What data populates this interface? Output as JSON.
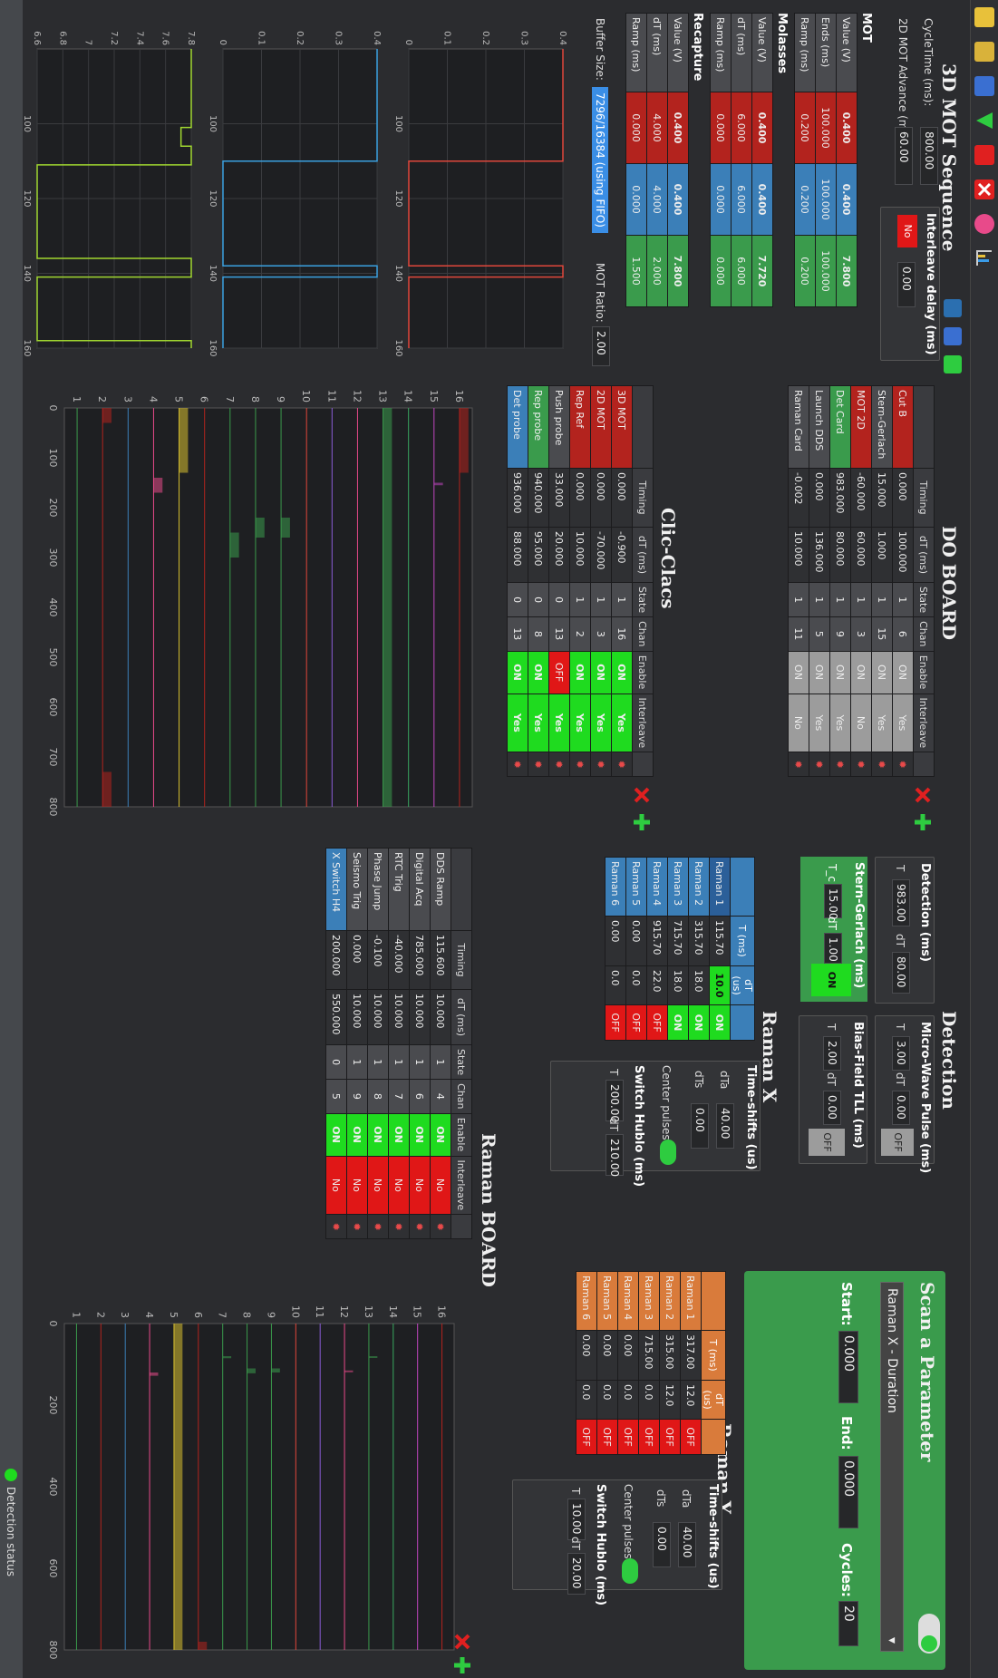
{
  "app": {
    "title": "3D MOT Sequence"
  },
  "sequence": {
    "cycle_label": "CycleTime (ms):",
    "cycle_value": "800.00",
    "advance_label": "2D MOT Advance (m",
    "advance_value": "60.00",
    "interleave_label": "Interleave delay (ms)",
    "interleave_toggle": "No",
    "interleave_value": "0.00",
    "buffer_label": "Buffer Size:",
    "buffer_value": "7296/16384 (using FIFO)",
    "mot_ratio_label": "MOT Ratio:",
    "mot_ratio_value": "2.00",
    "groups": [
      {
        "name": "MOT",
        "rows": [
          {
            "label": "Value (V)",
            "cells": [
              "0.400",
              "0.400",
              "7.800"
            ]
          },
          {
            "label": "Ends (ms)",
            "cells": [
              "100.000",
              "100.000",
              "100.000"
            ]
          },
          {
            "label": "Ramp (ms)",
            "cells": [
              "0.200",
              "0.200",
              "0.200"
            ]
          }
        ]
      },
      {
        "name": "Molasses",
        "rows": [
          {
            "label": "Value (V)",
            "cells": [
              "0.400",
              "0.400",
              "7.720"
            ]
          },
          {
            "label": "dT (ms)",
            "cells": [
              "6.000",
              "6.000",
              "6.000"
            ]
          },
          {
            "label": "Ramp (ms)",
            "cells": [
              "0.000",
              "0.000",
              "0.000"
            ]
          }
        ]
      },
      {
        "name": "Recapture",
        "rows": [
          {
            "label": "Value (V)",
            "cells": [
              "0.400",
              "0.400",
              "7.800"
            ]
          },
          {
            "label": "dT (ms)",
            "cells": [
              "4.000",
              "4.000",
              "2.000"
            ]
          },
          {
            "label": "Ramp (ms)",
            "cells": [
              "0.000",
              "0.000",
              "1.500"
            ]
          }
        ]
      }
    ]
  },
  "do_board": {
    "title": "DO BOARD",
    "headers": [
      "",
      "Timing",
      "dT (ms)",
      "State",
      "Chan",
      "Enable",
      "Interleave",
      ""
    ],
    "rows": [
      {
        "name": "Cut B",
        "t": "0.000",
        "dt": "100.000",
        "state": "1",
        "chan": "6",
        "enable": "ON",
        "inter": "Yes"
      },
      {
        "name": "Stern-Gerlach",
        "t": "15.000",
        "dt": "1.000",
        "state": "1",
        "chan": "15",
        "enable": "ON",
        "inter": "Yes"
      },
      {
        "name": "MOT 2D",
        "t": "-60.000",
        "dt": "60.000",
        "state": "1",
        "chan": "3",
        "enable": "ON",
        "inter": "No"
      },
      {
        "name": "Det Card",
        "t": "983.000",
        "dt": "80.000",
        "state": "1",
        "chan": "9",
        "enable": "ON",
        "inter": "Yes"
      },
      {
        "name": "Launch DDS",
        "t": "0.000",
        "dt": "136.000",
        "state": "1",
        "chan": "5",
        "enable": "ON",
        "inter": "Yes"
      },
      {
        "name": "Raman Card",
        "t": "-0.002",
        "dt": "10.000",
        "state": "1",
        "chan": "11",
        "enable": "ON",
        "inter": "No"
      }
    ]
  },
  "clic_clacs": {
    "title": "Clic-Clacs",
    "headers": [
      "",
      "Timing",
      "dT (ms)",
      "State",
      "Chan",
      "Enable",
      "Interleave",
      ""
    ],
    "rows": [
      {
        "name": "3D MOT",
        "t": "0.000",
        "dt": "-0.900",
        "state": "1",
        "chan": "16",
        "enable": "ON",
        "inter": "Yes"
      },
      {
        "name": "2D MOT",
        "t": "0.000",
        "dt": "-70.000",
        "state": "1",
        "chan": "3",
        "enable": "ON",
        "inter": "Yes"
      },
      {
        "name": "Rep Ref",
        "t": "0.000",
        "dt": "10.000",
        "state": "1",
        "chan": "2",
        "enable": "ON",
        "inter": "Yes"
      },
      {
        "name": "Push probe",
        "t": "33.000",
        "dt": "20.000",
        "state": "0",
        "chan": "13",
        "enable": "OFF",
        "inter": "Yes"
      },
      {
        "name": "Rep probe",
        "t": "940.000",
        "dt": "95.000",
        "state": "0",
        "chan": "8",
        "enable": "ON",
        "inter": "Yes"
      },
      {
        "name": "Det probe",
        "t": "936.000",
        "dt": "88.000",
        "state": "0",
        "chan": "13",
        "enable": "ON",
        "inter": "Yes"
      }
    ]
  },
  "detection": {
    "title": "Detection",
    "det_label": "Detection (ms)",
    "det_t": "983.00",
    "det_dt": "80.00",
    "mw_label": "Micro-Wave Pulse (ms)",
    "mw_t": "3.00",
    "mw_dt": "0.00",
    "mw_state": "OFF",
    "sg_label": "Stern-Gerlach (ms)",
    "sg_t": "15.00",
    "sg_dt": "1.00",
    "sg_state": "ON",
    "bias_label": "Bias-Field TLL (ms)",
    "bias_t": "2.00",
    "bias_dt": "0.00",
    "bias_state": "OFF",
    "t_lbl": "T",
    "dt_lbl": "dT",
    "tc_lbl": "T_c"
  },
  "scan": {
    "title": "Scan a Parameter",
    "param": "Raman X - Duration",
    "start_label": "Start:",
    "start_value": "0.000",
    "end_label": "End:",
    "end_value": "0.000",
    "cycles_label": "Cycles:",
    "cycles_value": "20"
  },
  "raman_x": {
    "title": "Raman X",
    "headers": [
      "",
      "T (ms)",
      "dT (us)",
      ""
    ],
    "rows": [
      {
        "name": "Raman 1",
        "t": "115.70",
        "dt": "10.0",
        "en": "ON"
      },
      {
        "name": "Raman 2",
        "t": "315.70",
        "dt": "18.0",
        "en": "ON"
      },
      {
        "name": "Raman 3",
        "t": "715.70",
        "dt": "18.0",
        "en": "ON"
      },
      {
        "name": "Raman 4",
        "t": "915.70",
        "dt": "22.0",
        "en": "OFF"
      },
      {
        "name": "Raman 5",
        "t": "0.00",
        "dt": "0.0",
        "en": "OFF"
      },
      {
        "name": "Raman 6",
        "t": "0.00",
        "dt": "0.0",
        "en": "OFF"
      }
    ],
    "ts_label": "Time-shifts (us)",
    "dta_label": "dTa",
    "dta_value": "40.00",
    "dts_label": "dTs",
    "dts_value": "0.00",
    "center_label": "Center pulses:",
    "hublo_label": "Switch Hublo (ms)",
    "hublo_t": "200.00",
    "hublo_dt": "210.00"
  },
  "raman_y": {
    "title": "Raman Y",
    "headers": [
      "",
      "T (ms)",
      "dT (us)",
      ""
    ],
    "rows": [
      {
        "name": "Raman 1",
        "t": "317.00",
        "dt": "12.0",
        "en": "OFF"
      },
      {
        "name": "Raman 2",
        "t": "315.00",
        "dt": "12.0",
        "en": "OFF"
      },
      {
        "name": "Raman 3",
        "t": "715.00",
        "dt": "0.0",
        "en": "OFF"
      },
      {
        "name": "Raman 4",
        "t": "0.00",
        "dt": "0.0",
        "en": "OFF"
      },
      {
        "name": "Raman 5",
        "t": "0.00",
        "dt": "0.0",
        "en": "OFF"
      },
      {
        "name": "Raman 6",
        "t": "0.00",
        "dt": "0.0",
        "en": "OFF"
      }
    ],
    "ts_label": "Time-shifts (us)",
    "dta_label": "dTa",
    "dta_value": "40.00",
    "dts_label": "dTs",
    "dts_value": "0.00",
    "center_label": "Center pulses:",
    "hublo_label": "Switch Hublo (ms)",
    "hublo_t": "10.00",
    "hublo_dt": "20.00"
  },
  "raman_board": {
    "title": "Raman BOARD",
    "headers": [
      "",
      "Timing",
      "dT (ms)",
      "State",
      "Chan",
      "Enable",
      "Interleave",
      ""
    ],
    "rows": [
      {
        "name": "DDS Ramp",
        "t": "115.600",
        "dt": "10.000",
        "state": "1",
        "chan": "4",
        "enable": "ON",
        "inter": "No"
      },
      {
        "name": "Digital Acq",
        "t": "785.000",
        "dt": "10.000",
        "state": "1",
        "chan": "6",
        "enable": "ON",
        "inter": "No"
      },
      {
        "name": "RTC Trig",
        "t": "-40.000",
        "dt": "10.000",
        "state": "1",
        "chan": "7",
        "enable": "ON",
        "inter": "No"
      },
      {
        "name": "Phase Jump",
        "t": "-0.100",
        "dt": "10.000",
        "state": "1",
        "chan": "8",
        "enable": "ON",
        "inter": "No"
      },
      {
        "name": "Seismo Trig",
        "t": "0.000",
        "dt": "10.000",
        "state": "1",
        "chan": "9",
        "enable": "ON",
        "inter": "No"
      },
      {
        "name": "X Switch H4",
        "t": "200.000",
        "dt": "550.000",
        "state": "0",
        "chan": "5",
        "enable": "ON",
        "inter": "No"
      }
    ]
  },
  "status": {
    "label": "Detection status"
  },
  "colors": {
    "red": "#b3231e",
    "blue": "#3b7fb8",
    "green": "#3a9b4c",
    "lime": "#1fdb1f",
    "orange": "#d97b3b"
  },
  "chart_data": [
    {
      "type": "line",
      "series": [
        {
          "values_x": [
            80,
            110,
            110,
            138,
            138,
            141,
            141,
            160
          ],
          "values_y": [
            0.4,
            0.4,
            0.0,
            0.0,
            0.4,
            0.4,
            0.0,
            0.0
          ]
        }
      ],
      "xlim": [
        80,
        160
      ],
      "ylim": [
        0,
        0.4
      ],
      "yticks": [
        "0",
        "0.1",
        "0.2",
        "0.3",
        "0.4"
      ],
      "xticks": [
        "100",
        "120",
        "140",
        "160"
      ]
    },
    {
      "type": "line",
      "series": [
        {
          "values_x": [
            80,
            110,
            110,
            138,
            138,
            141,
            141,
            160
          ],
          "values_y": [
            0.4,
            0.4,
            0.0,
            0.0,
            0.4,
            0.4,
            0.0,
            0.0
          ]
        }
      ],
      "xlim": [
        80,
        160
      ],
      "ylim": [
        0,
        0.4
      ],
      "yticks": [
        "0",
        "0.1",
        "0.2",
        "0.3",
        "0.4"
      ],
      "xticks": [
        "100",
        "120",
        "140",
        "160"
      ]
    },
    {
      "type": "line",
      "series": [
        {
          "values_x": [
            80,
            101,
            101,
            106,
            106,
            111,
            111,
            136,
            136,
            141,
            141,
            158,
            158,
            160
          ],
          "values_y": [
            7.8,
            7.8,
            7.72,
            7.72,
            7.8,
            7.8,
            6.6,
            6.6,
            7.8,
            7.8,
            6.6,
            6.6,
            7.8,
            7.8
          ]
        }
      ],
      "xlim": [
        80,
        160
      ],
      "ylim": [
        6.6,
        7.8
      ],
      "yticks": [
        "6.6",
        "6.8",
        "7",
        "7.2",
        "7.4",
        "7.6",
        "7.8"
      ],
      "xticks": [
        "100",
        "120",
        "140",
        "160"
      ]
    },
    {
      "type": "line",
      "xticks": [
        "0",
        "100",
        "200",
        "300",
        "400",
        "500",
        "600",
        "700",
        "800"
      ],
      "yticks": [
        "1",
        "2",
        "3",
        "4",
        "5",
        "6",
        "7",
        "8",
        "9",
        "10",
        "11",
        "12",
        "13",
        "14",
        "15",
        "16"
      ]
    },
    {
      "type": "line",
      "xticks": [
        "0",
        "200",
        "400",
        "600",
        "800"
      ],
      "yticks": [
        "1",
        "2",
        "3",
        "4",
        "5",
        "6",
        "7",
        "8",
        "9",
        "10",
        "11",
        "12",
        "13",
        "14",
        "15",
        "16"
      ]
    }
  ]
}
